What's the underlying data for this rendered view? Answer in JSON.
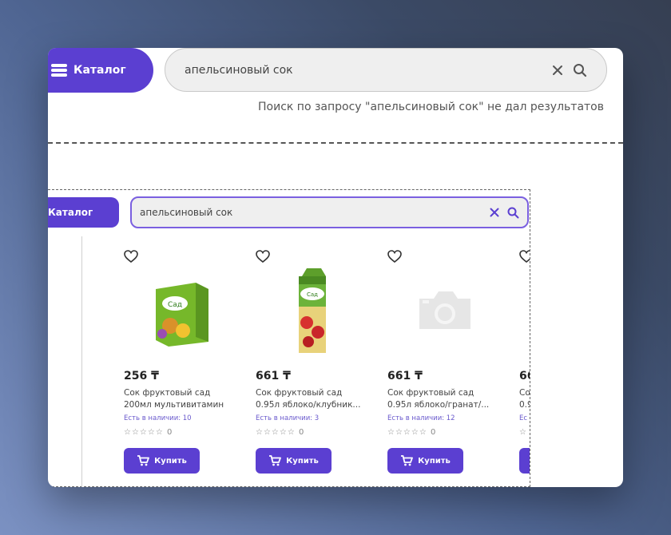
{
  "colors": {
    "accent": "#5b3fd1",
    "stock": "#6a5acd"
  },
  "header": {
    "catalog_label": "Каталог",
    "search_value": "апельсиновый сок",
    "no_results": "Поиск по запросу \"апельсиновый сок\" не дал результатов"
  },
  "frame": {
    "catalog_label": "Каталог",
    "search_value": "апельсиновый сок"
  },
  "products": [
    {
      "price": "256 ₸",
      "name_line1": "Сок фруктовый сад",
      "name_line2": "200мл мультивитамин",
      "stock": "Есть в наличии: 10",
      "stars": "☆☆☆☆☆",
      "rating_count": "0",
      "buy_label": "Купить",
      "image": "juice-box-small"
    },
    {
      "price": "661 ₸",
      "name_line1": "Сок фруктовый сад",
      "name_line2": "0.95л яблоко/клубник...",
      "stock": "Есть в наличии: 3",
      "stars": "☆☆☆☆☆",
      "rating_count": "0",
      "buy_label": "Купить",
      "image": "juice-box-tall"
    },
    {
      "price": "661 ₸",
      "name_line1": "Сок фруктовый сад",
      "name_line2": "0.95л яблоко/гранат/...",
      "stock": "Есть в наличии: 12",
      "stars": "☆☆☆☆☆",
      "rating_count": "0",
      "buy_label": "Купить",
      "image": "camera-placeholder"
    },
    {
      "price": "66",
      "name_line1": "Со",
      "name_line2": "0.9",
      "stock": "Ес",
      "stars": "☆",
      "buy_label": ""
    }
  ]
}
